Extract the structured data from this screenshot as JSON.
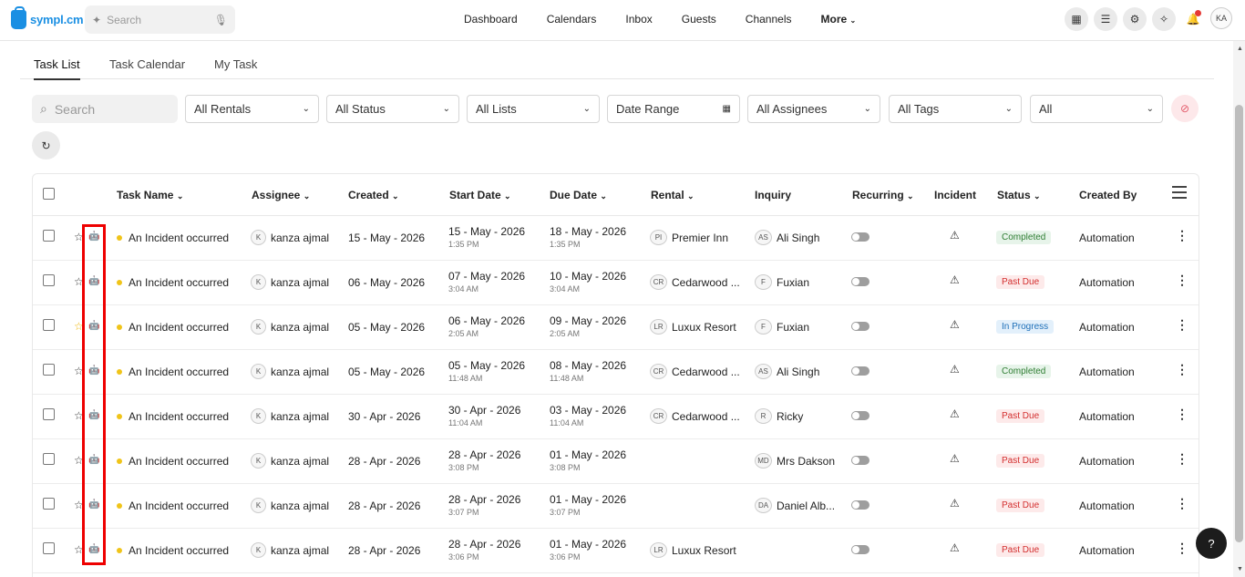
{
  "app": {
    "logo_text": "sympl.cm"
  },
  "topbar": {
    "search_placeholder": "Search",
    "nav": [
      "Dashboard",
      "Calendars",
      "Inbox",
      "Guests",
      "Channels"
    ],
    "more_label": "More",
    "avatar_initials": "KA"
  },
  "tabs": [
    "Task List",
    "Task Calendar",
    "My Task"
  ],
  "filters": {
    "search_placeholder": "Search",
    "rentals": "All Rentals",
    "status": "All Status",
    "lists": "All Lists",
    "date_range": "Date Range",
    "assignees": "All Assignees",
    "tags": "All Tags",
    "all": "All"
  },
  "table": {
    "headers": [
      "Task Name",
      "Assignee",
      "Created",
      "Start Date",
      "Due Date",
      "Rental",
      "Inquiry",
      "Recurring",
      "Incident",
      "Status",
      "Created By"
    ],
    "rows": [
      {
        "task": "An Incident occurred",
        "assignee_initial": "K",
        "assignee": "kanza ajmal",
        "created": "15 - May - 2026",
        "start": "15 - May - 2026",
        "start_time": "1:35 PM",
        "due": "18 - May - 2026",
        "due_time": "1:35 PM",
        "rental_initials": "PI",
        "rental": "Premier Inn",
        "inquiry_initials": "AS",
        "inquiry": "Ali Singh",
        "status": "Completed",
        "status_kind": "completed",
        "created_by": "Automation",
        "favorite": false
      },
      {
        "task": "An Incident occurred",
        "assignee_initial": "K",
        "assignee": "kanza ajmal",
        "created": "06 - May - 2026",
        "start": "07 - May - 2026",
        "start_time": "3:04 AM",
        "due": "10 - May - 2026",
        "due_time": "3:04 AM",
        "rental_initials": "CR",
        "rental": "Cedarwood ...",
        "inquiry_initials": "F",
        "inquiry": "Fuxian",
        "status": "Past Due",
        "status_kind": "pastdue",
        "created_by": "Automation",
        "favorite": false
      },
      {
        "task": "An Incident occurred",
        "assignee_initial": "K",
        "assignee": "kanza ajmal",
        "created": "05 - May - 2026",
        "start": "06 - May - 2026",
        "start_time": "2:05 AM",
        "due": "09 - May - 2026",
        "due_time": "2:05 AM",
        "rental_initials": "LR",
        "rental": "Luxux Resort",
        "inquiry_initials": "F",
        "inquiry": "Fuxian",
        "status": "In Progress",
        "status_kind": "inprogress",
        "created_by": "Automation",
        "favorite": true
      },
      {
        "task": "An Incident occurred",
        "assignee_initial": "K",
        "assignee": "kanza ajmal",
        "created": "05 - May - 2026",
        "start": "05 - May - 2026",
        "start_time": "11:48 AM",
        "due": "08 - May - 2026",
        "due_time": "11:48 AM",
        "rental_initials": "CR",
        "rental": "Cedarwood ...",
        "inquiry_initials": "AS",
        "inquiry": "Ali Singh",
        "status": "Completed",
        "status_kind": "completed",
        "created_by": "Automation",
        "favorite": false
      },
      {
        "task": "An Incident occurred",
        "assignee_initial": "K",
        "assignee": "kanza ajmal",
        "created": "30 - Apr - 2026",
        "start": "30 - Apr - 2026",
        "start_time": "11:04 AM",
        "due": "03 - May - 2026",
        "due_time": "11:04 AM",
        "rental_initials": "CR",
        "rental": "Cedarwood ...",
        "inquiry_initials": "R",
        "inquiry": "Ricky",
        "status": "Past Due",
        "status_kind": "pastdue",
        "created_by": "Automation",
        "favorite": false
      },
      {
        "task": "An Incident occurred",
        "assignee_initial": "K",
        "assignee": "kanza ajmal",
        "created": "28 - Apr - 2026",
        "start": "28 - Apr - 2026",
        "start_time": "3:08 PM",
        "due": "01 - May - 2026",
        "due_time": "3:08 PM",
        "rental_initials": "",
        "rental": "",
        "inquiry_initials": "MD",
        "inquiry": "Mrs Dakson",
        "status": "Past Due",
        "status_kind": "pastdue",
        "created_by": "Automation",
        "favorite": false
      },
      {
        "task": "An Incident occurred",
        "assignee_initial": "K",
        "assignee": "kanza ajmal",
        "created": "28 - Apr - 2026",
        "start": "28 - Apr - 2026",
        "start_time": "3:07 PM",
        "due": "01 - May - 2026",
        "due_time": "3:07 PM",
        "rental_initials": "",
        "rental": "",
        "inquiry_initials": "DA",
        "inquiry": "Daniel Alb...",
        "status": "Past Due",
        "status_kind": "pastdue",
        "created_by": "Automation",
        "favorite": false
      },
      {
        "task": "An Incident occurred",
        "assignee_initial": "K",
        "assignee": "kanza ajmal",
        "created": "28 - Apr - 2026",
        "start": "28 - Apr - 2026",
        "start_time": "3:06 PM",
        "due": "01 - May - 2026",
        "due_time": "3:06 PM",
        "rental_initials": "LR",
        "rental": "Luxux Resort",
        "inquiry_initials": "",
        "inquiry": "",
        "status": "Past Due",
        "status_kind": "pastdue",
        "created_by": "Automation",
        "favorite": false
      }
    ]
  },
  "help_label": "?"
}
